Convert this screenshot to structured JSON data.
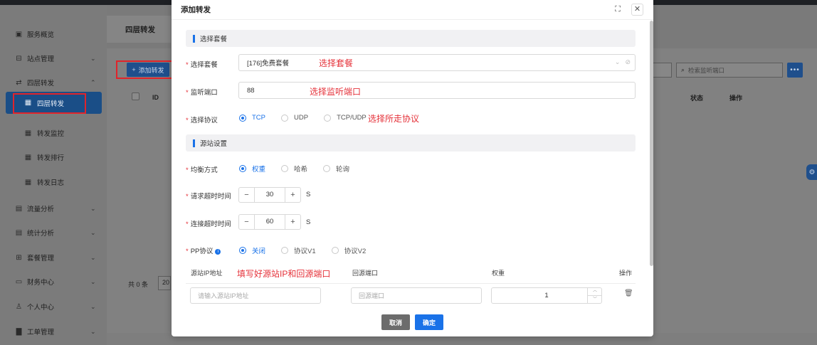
{
  "sidebar": {
    "items": [
      {
        "label": "服务概览",
        "icon": "dashboard-icon",
        "chevron": ""
      },
      {
        "label": "站点管理",
        "icon": "site-icon",
        "chevron": "⌄"
      },
      {
        "label": "四层转发",
        "icon": "forward-icon",
        "chevron": "⌃"
      },
      {
        "label": "四层转发",
        "icon": "grid-icon",
        "chevron": ""
      },
      {
        "label": "转发监控",
        "icon": "grid-icon",
        "chevron": ""
      },
      {
        "label": "转发排行",
        "icon": "grid-icon",
        "chevron": ""
      },
      {
        "label": "转发日志",
        "icon": "grid-icon",
        "chevron": ""
      },
      {
        "label": "流量分析",
        "icon": "doc-icon",
        "chevron": "⌄"
      },
      {
        "label": "统计分析",
        "icon": "doc-icon",
        "chevron": "⌄"
      },
      {
        "label": "套餐管理",
        "icon": "package-icon",
        "chevron": "⌄"
      },
      {
        "label": "财务中心",
        "icon": "finance-icon",
        "chevron": "⌄"
      },
      {
        "label": "个人中心",
        "icon": "user-icon",
        "chevron": "⌄"
      },
      {
        "label": "工单管理",
        "icon": "ticket-icon",
        "chevron": "⌄"
      }
    ]
  },
  "page": {
    "title": "四层转发",
    "add_button": "添加转发",
    "table_headers": {
      "id": "ID",
      "status": "状态",
      "ops": "操作"
    },
    "total": "共 0 条",
    "page_size": "20",
    "search_placeholder": "检索监听端口",
    "more": "•••"
  },
  "modal": {
    "title": "添加转发",
    "section_package": "选择套餐",
    "package_label": "选择套餐",
    "package_value": "[176]免费套餐",
    "package_note": "选择套餐",
    "port_label": "监听端口",
    "port_value": "88",
    "port_note": "选择监听端口",
    "protocol_label": "选择协议",
    "protocol_options": [
      "TCP",
      "UDP",
      "TCP/UDP"
    ],
    "protocol_selected": "TCP",
    "protocol_note": "选择所走协议",
    "section_origin": "源站设置",
    "balance_label": "均衡方式",
    "balance_options": [
      "权重",
      "哈希",
      "轮询"
    ],
    "balance_selected": "权重",
    "req_timeout_label": "请求超时时间",
    "req_timeout_value": "30",
    "conn_timeout_label": "连接超时时间",
    "conn_timeout_value": "60",
    "unit": "S",
    "pp_label": "PP协议",
    "pp_options": [
      "关闭",
      "协议V1",
      "协议V2"
    ],
    "pp_selected": "关闭",
    "origin_headers": {
      "ip": "源站IP地址",
      "port": "回源端口",
      "weight": "权重",
      "ops": "操作"
    },
    "origin_note": "填写好源站IP和回源端口",
    "ip_placeholder": "请输入源站IP地址",
    "port_placeholder": "回源端口",
    "weight_value": "1",
    "cancel": "取消",
    "confirm": "确定"
  },
  "colors": {
    "primary": "#1a72e8",
    "note_red": "#e5323a",
    "highlight_box": "#e0242b"
  }
}
